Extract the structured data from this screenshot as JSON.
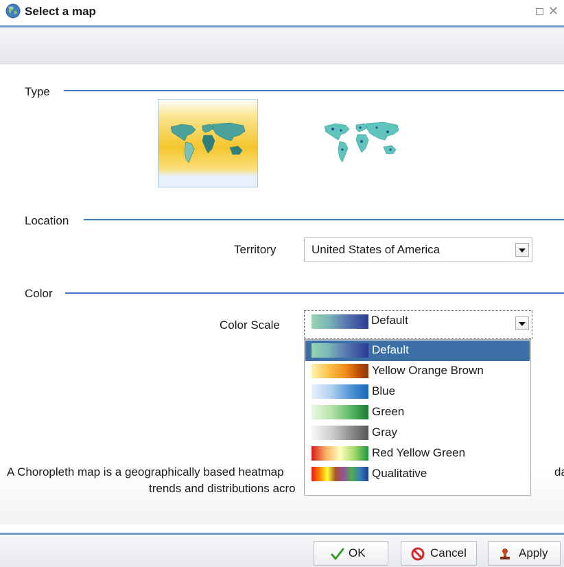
{
  "window": {
    "title": "Select a map",
    "globe_icon": "globe-icon",
    "maximize_icon": "maximize-icon",
    "close_icon": "close-icon",
    "close_glyph": "✕"
  },
  "sections": {
    "type": "Type",
    "location": "Location",
    "color": "Color"
  },
  "map_types": [
    {
      "name": "choropleth-map",
      "icon": "choropleth-world-map-icon",
      "selected": true
    },
    {
      "name": "bubble-map",
      "icon": "bubble-world-map-icon",
      "selected": false
    }
  ],
  "territory": {
    "label": "Territory",
    "value": "United States of America"
  },
  "color_scale": {
    "label": "Color Scale",
    "value": "Default",
    "options": [
      {
        "label": "Default",
        "selected": true
      },
      {
        "label": "Yellow Orange Brown",
        "selected": false
      },
      {
        "label": "Blue",
        "selected": false
      },
      {
        "label": "Green",
        "selected": false
      },
      {
        "label": "Gray",
        "selected": false
      },
      {
        "label": "Red Yellow Green",
        "selected": false
      },
      {
        "label": "Qualitative",
        "selected": false
      }
    ]
  },
  "description": {
    "line1": "A Choropleth map is a geographically based heatmap",
    "line1_tail": "data,",
    "line2": "trends and distributions acro"
  },
  "buttons": {
    "ok": "OK",
    "cancel": "Cancel",
    "apply": "Apply"
  },
  "colors": {
    "accent_rule": "#3d74c6",
    "selected_option": "#3d6fa7"
  }
}
